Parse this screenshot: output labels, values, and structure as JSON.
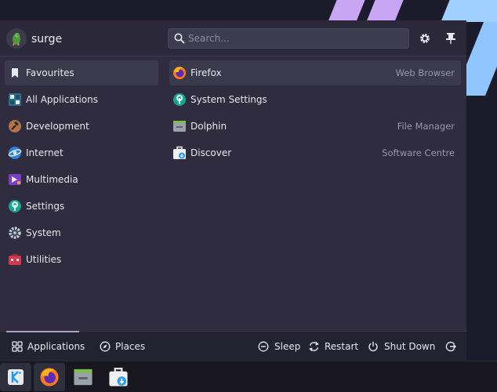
{
  "user": {
    "name": "surge"
  },
  "search": {
    "placeholder": "Search..."
  },
  "categories": [
    {
      "label": "Favourites",
      "icon": "bookmark-icon",
      "active": true
    },
    {
      "label": "All Applications",
      "icon": "all-applications-icon"
    },
    {
      "label": "Development",
      "icon": "development-hammer-icon"
    },
    {
      "label": "Internet",
      "icon": "internet-globe-icon"
    },
    {
      "label": "Multimedia",
      "icon": "multimedia-icon"
    },
    {
      "label": "Settings",
      "icon": "settings-wrench-icon"
    },
    {
      "label": "System",
      "icon": "system-gear-icon"
    },
    {
      "label": "Utilities",
      "icon": "utilities-icon"
    }
  ],
  "apps": [
    {
      "label": "Firefox",
      "description": "Web Browser",
      "icon": "firefox-icon"
    },
    {
      "label": "System Settings",
      "description": "",
      "icon": "system-settings-icon"
    },
    {
      "label": "Dolphin",
      "description": "File Manager",
      "icon": "dolphin-folder-icon"
    },
    {
      "label": "Discover",
      "description": "Software Centre",
      "icon": "discover-icon"
    }
  ],
  "footer": {
    "tabs": [
      {
        "label": "Applications",
        "icon": "applications-grid-icon",
        "active": true
      },
      {
        "label": "Places",
        "icon": "places-compass-icon"
      }
    ],
    "power": [
      {
        "label": "Sleep",
        "icon": "sleep-icon"
      },
      {
        "label": "Restart",
        "icon": "restart-icon"
      },
      {
        "label": "Shut Down",
        "icon": "shutdown-icon"
      }
    ]
  },
  "colors": {
    "panel": "#2e2c3e",
    "highlight": "#3b394c",
    "taskbar": "#18171f",
    "accent": "#a8a4c8"
  }
}
